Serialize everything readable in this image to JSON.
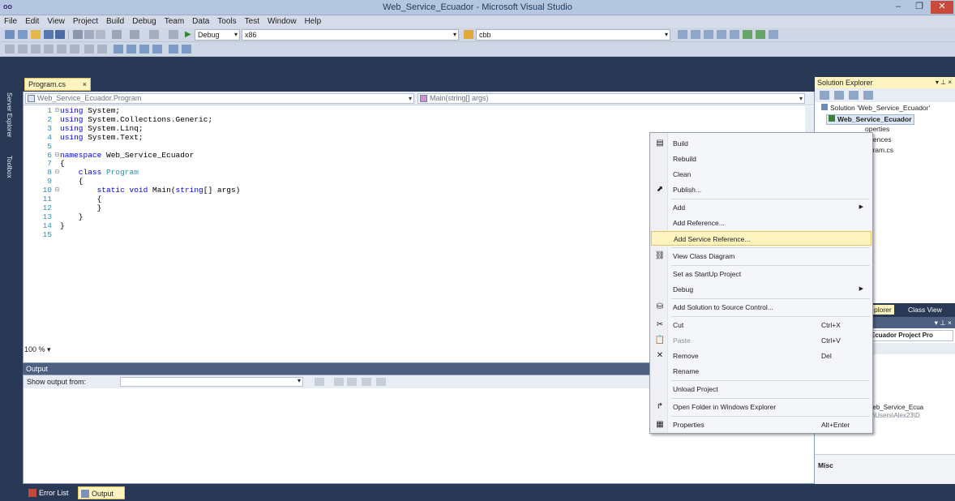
{
  "window": {
    "app_icon": "oo",
    "title": "Web_Service_Ecuador - Microsoft Visual Studio",
    "minimize": "–",
    "restore": "❐",
    "close": "✕"
  },
  "menubar": {
    "items": [
      "File",
      "Edit",
      "View",
      "Project",
      "Build",
      "Debug",
      "Team",
      "Data",
      "Tools",
      "Test",
      "Window",
      "Help"
    ]
  },
  "toolbar": {
    "config_combo": "Debug",
    "platform_combo": "x86",
    "find_combo": "cbb"
  },
  "left_sidebar": {
    "server_explorer": "Server Explorer",
    "toolbox": "Toolbox"
  },
  "editor": {
    "tab_label": "Program.cs",
    "tab_close": "×",
    "nav_left": "Web_Service_Ecuador.Program",
    "nav_right": "Main(string[] args)",
    "zoom": "100 %",
    "lines": [
      {
        "n": "1",
        "tokens": [
          {
            "t": "using",
            "c": "kw"
          },
          {
            "t": " System;",
            "c": ""
          }
        ]
      },
      {
        "n": "2",
        "tokens": [
          {
            "t": "using",
            "c": "kw"
          },
          {
            "t": " System.Collections.Generic;",
            "c": ""
          }
        ]
      },
      {
        "n": "3",
        "tokens": [
          {
            "t": "using",
            "c": "kw"
          },
          {
            "t": " System.Linq;",
            "c": ""
          }
        ]
      },
      {
        "n": "4",
        "tokens": [
          {
            "t": "using",
            "c": "kw"
          },
          {
            "t": " System.Text;",
            "c": ""
          }
        ]
      },
      {
        "n": "5",
        "tokens": []
      },
      {
        "n": "6",
        "tokens": [
          {
            "t": "namespace",
            "c": "kw"
          },
          {
            "t": " Web_Service_Ecuador",
            "c": ""
          }
        ]
      },
      {
        "n": "7",
        "tokens": [
          {
            "t": "{",
            "c": ""
          }
        ]
      },
      {
        "n": "8",
        "tokens": [
          {
            "t": "    class ",
            "c": "kw"
          },
          {
            "t": "Program",
            "c": "ty"
          }
        ]
      },
      {
        "n": "9",
        "tokens": [
          {
            "t": "    {",
            "c": ""
          }
        ]
      },
      {
        "n": "10",
        "tokens": [
          {
            "t": "        static void ",
            "c": "kw"
          },
          {
            "t": "Main(",
            "c": ""
          },
          {
            "t": "string",
            "c": "kw"
          },
          {
            "t": "[] args)",
            "c": ""
          }
        ]
      },
      {
        "n": "11",
        "tokens": [
          {
            "t": "        {",
            "c": ""
          }
        ]
      },
      {
        "n": "12",
        "tokens": [
          {
            "t": "        }",
            "c": ""
          }
        ]
      },
      {
        "n": "13",
        "tokens": [
          {
            "t": "    }",
            "c": ""
          }
        ]
      },
      {
        "n": "14",
        "tokens": [
          {
            "t": "}",
            "c": ""
          }
        ]
      },
      {
        "n": "15",
        "tokens": []
      }
    ]
  },
  "output": {
    "header": "Output",
    "show_output_from": "Show output from:"
  },
  "bottom_tabs": {
    "error_list": "Error List",
    "output": "Output"
  },
  "solution_explorer": {
    "header": "Solution Explorer",
    "pins": "▾ ⊥ ×",
    "solution": "Solution 'Web_Service_Ecuador'",
    "project": "Web_Service_Ecuador",
    "children": [
      "operties",
      "ferences",
      "ogram.cs"
    ],
    "tab_left": "plorer",
    "tab_right": "Class View"
  },
  "properties": {
    "pins": "▾ ⊥ ×",
    "combo": "Ecuador Project Pro",
    "row_value": "Web_Service_Ecua",
    "row_path": "C:\\Users\\Alex23\\D",
    "desc_title": "Misc"
  },
  "context_menu": {
    "items": [
      {
        "label": "Build",
        "icon": "build-icon",
        "glyph": "▤",
        "sep_after": false
      },
      {
        "label": "Rebuild",
        "sep_after": false
      },
      {
        "label": "Clean",
        "sep_after": false
      },
      {
        "label": "Publish...",
        "icon": "publish-icon",
        "glyph": "⬈",
        "sep_after": true
      },
      {
        "label": "Add",
        "submenu": true,
        "sep_after": false
      },
      {
        "label": "Add Reference...",
        "sep_after": false
      },
      {
        "label": "Add Service Reference...",
        "highlight": true,
        "sep_after": true
      },
      {
        "label": "View Class Diagram",
        "icon": "class-diagram-icon",
        "glyph": "⛓",
        "sep_after": true
      },
      {
        "label": "Set as StartUp Project",
        "sep_after": false
      },
      {
        "label": "Debug",
        "submenu": true,
        "sep_after": true
      },
      {
        "label": "Add Solution to Source Control...",
        "icon": "source-control-icon",
        "glyph": "⛁",
        "sep_after": true
      },
      {
        "label": "Cut",
        "shortcut": "Ctrl+X",
        "icon": "cut-icon",
        "glyph": "✂",
        "sep_after": false
      },
      {
        "label": "Paste",
        "shortcut": "Ctrl+V",
        "icon": "paste-icon",
        "glyph": "📋",
        "disabled": true,
        "sep_after": false
      },
      {
        "label": "Remove",
        "shortcut": "Del",
        "icon": "remove-icon",
        "glyph": "✕",
        "sep_after": false
      },
      {
        "label": "Rename",
        "sep_after": true
      },
      {
        "label": "Unload Project",
        "sep_after": true
      },
      {
        "label": "Open Folder in Windows Explorer",
        "icon": "open-folder-icon",
        "glyph": "↱",
        "sep_after": true
      },
      {
        "label": "Properties",
        "shortcut": "Alt+Enter",
        "icon": "properties-icon",
        "glyph": "▦",
        "sep_after": false
      }
    ]
  }
}
